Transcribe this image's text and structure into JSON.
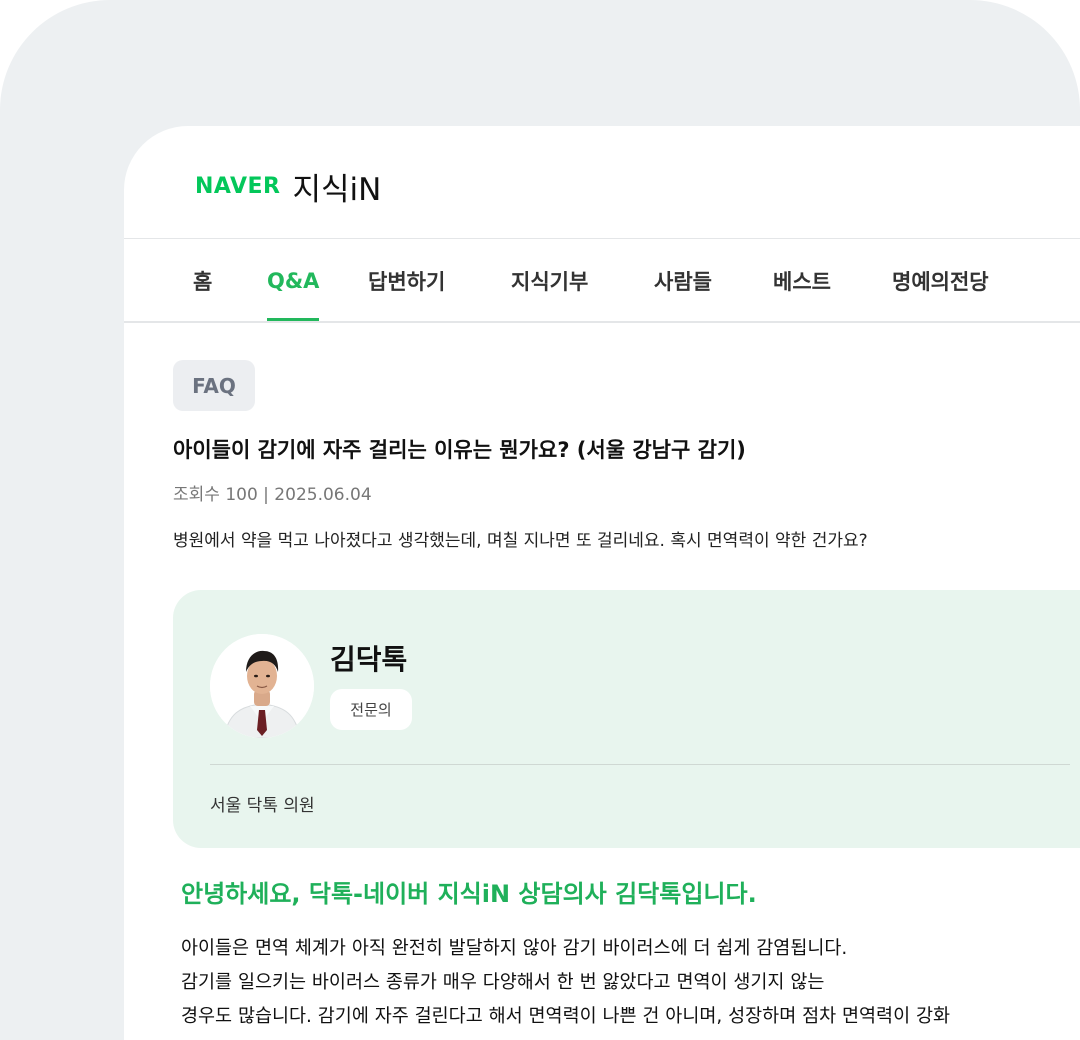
{
  "logo": {
    "brand": "NAVER",
    "service": "지식iN"
  },
  "nav": {
    "items": [
      {
        "label": "홈"
      },
      {
        "label": "Q&A"
      },
      {
        "label": "답변하기"
      },
      {
        "label": "지식기부"
      },
      {
        "label": "사람들"
      },
      {
        "label": "베스트"
      },
      {
        "label": "명예의전당"
      }
    ],
    "active": "Q&A"
  },
  "question": {
    "badge": "FAQ",
    "title": "아이들이 감기에 자주 걸리는 이유는 뭔가요? (서울 강남구 감기)",
    "meta": "조회수 100 | 2025.06.04",
    "body": "병원에서 약을 먹고 나아졌다고 생각했는데, 며칠 지나면 또 걸리네요. 혹시 면역력이 약한 건가요?"
  },
  "answer": {
    "doctor_name": "김닥톡",
    "doctor_role": "전문의",
    "clinic": "서울 닥톡 의원",
    "greeting": "안녕하세요, 닥톡-네이버 지식iN 상담의사 김닥톡입니다.",
    "lines": [
      "아이들은 면역 체계가 아직 완전히 발달하지 않아 감기 바이러스에 더 쉽게 감염됩니다.",
      "감기를 일으키는 바이러스 종류가 매우 다양해서 한 번 앓았다고 면역이 생기지 않는",
      "경우도 많습니다. 감기에 자주 걸린다고 해서 면역력이 나쁜 건 아니며, 성장하며 점차 면역력이 강화"
    ]
  },
  "colors": {
    "accent": "#22b85c",
    "answer_bg": "#e8f5ee"
  }
}
